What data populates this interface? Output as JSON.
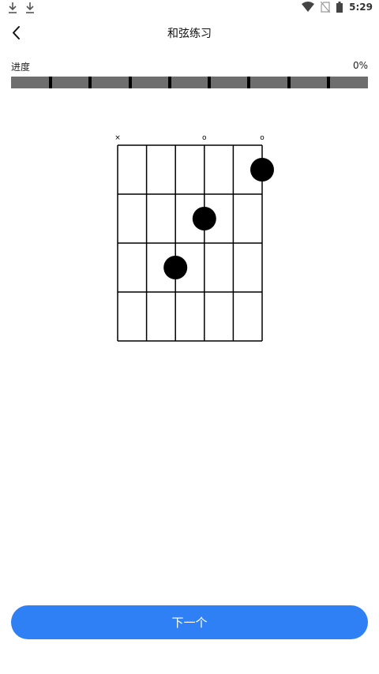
{
  "status_bar": {
    "time": "5:29",
    "left_icons": [
      "download-icon",
      "download-icon"
    ],
    "right_icons": [
      "wifi-icon",
      "no-sim-icon",
      "battery-icon"
    ]
  },
  "header": {
    "title": "和弦练习",
    "back_icon": "chevron-left-icon"
  },
  "progress": {
    "label": "进度",
    "value_text": "0%",
    "fraction": 0,
    "segments": 9
  },
  "chord": {
    "strings": 6,
    "frets": 4,
    "open_markers": [
      "×",
      "",
      "",
      "o",
      "",
      "o"
    ],
    "fingers": [
      {
        "string": 5,
        "fret": 1
      },
      {
        "string": 3,
        "fret": 2
      },
      {
        "string": 2,
        "fret": 3
      }
    ]
  },
  "next_button": {
    "label": "下一个"
  },
  "colors": {
    "accent": "#2f80f5",
    "track": "#6e6e6e"
  }
}
